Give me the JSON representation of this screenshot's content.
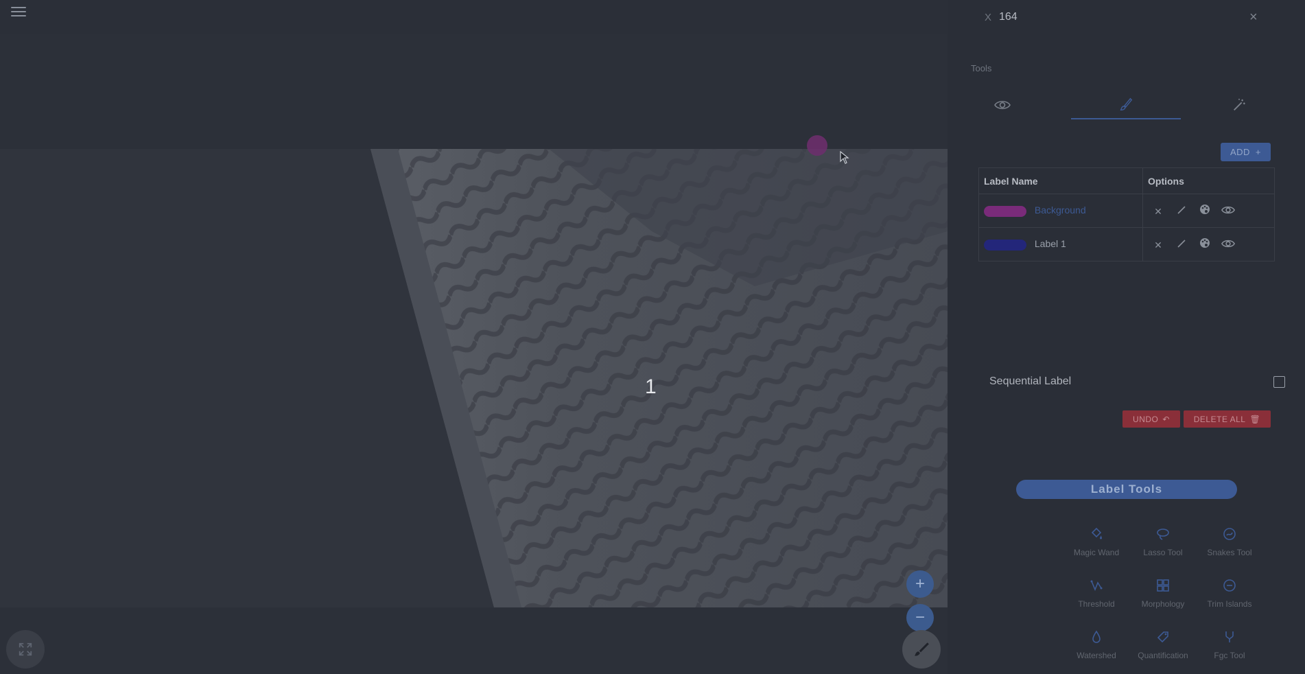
{
  "header": {
    "menu_icon": "hamburger-icon"
  },
  "canvas": {
    "image_label": "1",
    "zoom_in": "+",
    "zoom_out": "−",
    "brush_color": "#6b2f6b"
  },
  "panel": {
    "x_label": "X",
    "x_value": "164",
    "close": "×",
    "tools_title": "Tools",
    "tabs": [
      {
        "icon": "eye-icon"
      },
      {
        "icon": "brush-icon"
      },
      {
        "icon": "magic-wand-icon"
      }
    ],
    "add_label": "ADD",
    "table": {
      "headers": [
        "Label Name",
        "Options"
      ],
      "rows": [
        {
          "name": "Background",
          "color": "#7a2b7a"
        },
        {
          "name": "Label 1",
          "color": "#23267a"
        }
      ]
    },
    "sequential_label": "Sequential Label",
    "undo_label": "UNDO",
    "delete_all_label": "DELETE ALL",
    "label_tools_title": "Label Tools",
    "tools": [
      {
        "label": "Magic Wand",
        "icon": "paint-bucket-icon"
      },
      {
        "label": "Lasso Tool",
        "icon": "lasso-icon"
      },
      {
        "label": "Snakes Tool",
        "icon": "snake-icon"
      },
      {
        "label": "Threshold",
        "icon": "threshold-icon"
      },
      {
        "label": "Morphology",
        "icon": "morphology-icon"
      },
      {
        "label": "Trim Islands",
        "icon": "trim-icon"
      },
      {
        "label": "Watershed",
        "icon": "watershed-icon"
      },
      {
        "label": "Quantification",
        "icon": "tag-icon"
      },
      {
        "label": "Fgc Tool",
        "icon": "fork-icon"
      }
    ]
  },
  "colors": {
    "accent": "#3d5a94",
    "danger": "#8a2f39",
    "background": "#282c35"
  }
}
